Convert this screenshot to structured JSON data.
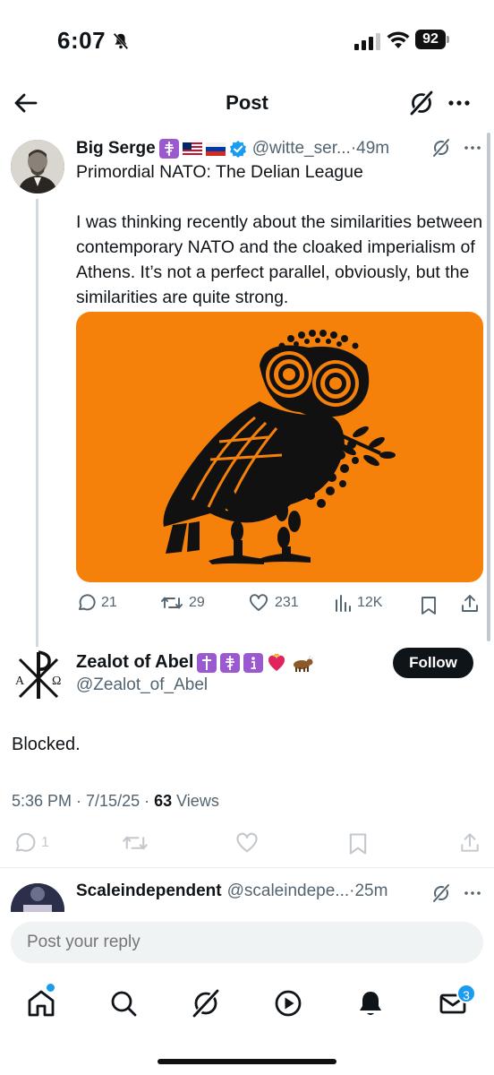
{
  "status_bar": {
    "time": "6:07",
    "battery": "92"
  },
  "header": {
    "title": "Post"
  },
  "original_post": {
    "author_name": "Big Serge",
    "handle": "@witte_ser...",
    "time": "·49m",
    "text": "Primordial NATO: The Delian League\n\nI was thinking recently about the similarities between contemporary NATO and the cloaked imperialism of Athens. It’s not a perfect parallel, obviously, but the similarities are quite strong.",
    "replies": "21",
    "reposts": "29",
    "likes": "231",
    "views": "12K",
    "image_bg": "#f5800a"
  },
  "focused_reply": {
    "author_name": "Zealot of Abel",
    "handle": "@Zealot_of_Abel",
    "follow_label": "Follow",
    "text": "Blocked.",
    "timestamp": "5:36 PM · 7/15/25 · ",
    "views_count": "63",
    "views_label": " Views",
    "replies": "1"
  },
  "next_reply": {
    "author_name": "Scaleindependent",
    "handle": "@scaleindepe...",
    "time": "·25m"
  },
  "reply_box": {
    "placeholder": "Post your reply"
  },
  "bottom_nav": {
    "messages_badge": "3"
  },
  "colors": {
    "accent": "#1d9bf0",
    "text": "#0f1419",
    "secondary": "#536471"
  }
}
